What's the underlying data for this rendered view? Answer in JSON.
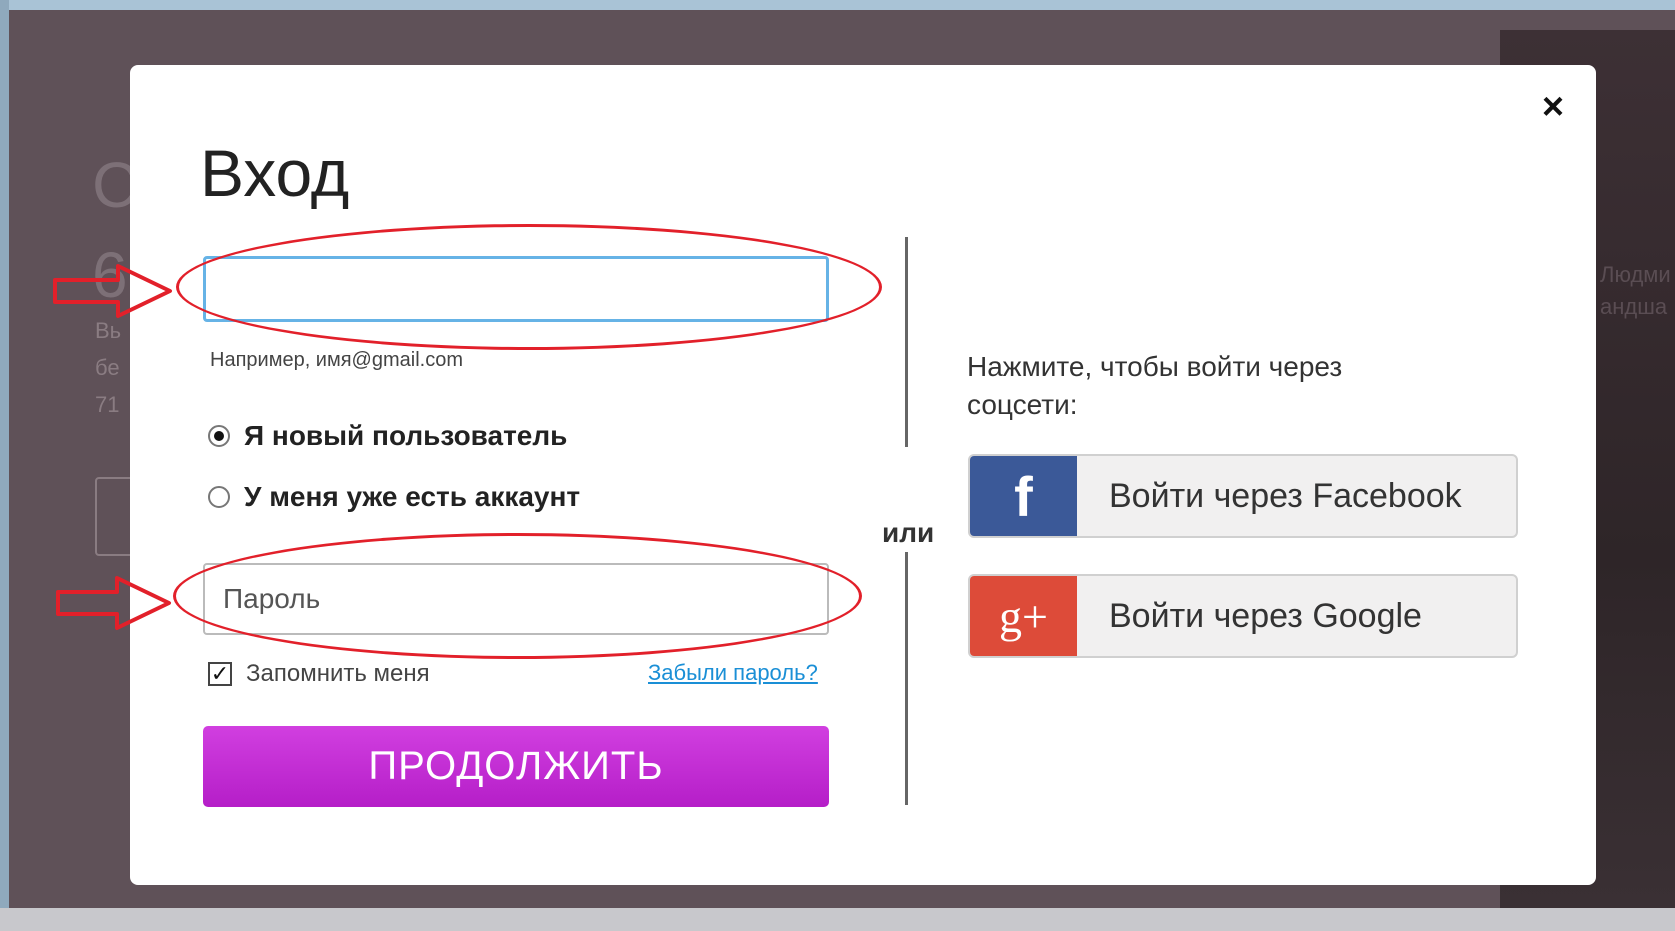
{
  "background": {
    "big_char": "С\n6",
    "left_lines": [
      "Вь",
      "бе",
      "71"
    ],
    "right_lines": [
      "Людми",
      "андша"
    ]
  },
  "modal": {
    "title": "Вход",
    "close_glyph": "×",
    "email": {
      "value": "",
      "placeholder": "",
      "hint": "Например, имя@gmail.com"
    },
    "radios": [
      {
        "label": "Я новый пользователь",
        "selected": true
      },
      {
        "label": "У меня уже есть аккаунт",
        "selected": false
      }
    ],
    "password": {
      "value": "",
      "placeholder": "Пароль"
    },
    "remember": {
      "label": "Запомнить меня",
      "checked": true,
      "check_glyph": "✓"
    },
    "forgot_link": "Забыли пароль?",
    "continue_label": "ПРОДОЛЖИТЬ",
    "or_label": "или",
    "social": {
      "caption": "Нажмите, чтобы войти через соцсети:",
      "facebook": {
        "icon_glyph": "f",
        "label": "Войти через Facebook",
        "color": "#3b5998"
      },
      "google": {
        "icon_glyph": "g+",
        "label": "Войти через Google",
        "color": "#dd4b39"
      }
    }
  },
  "annotation_color": "#e2202a"
}
